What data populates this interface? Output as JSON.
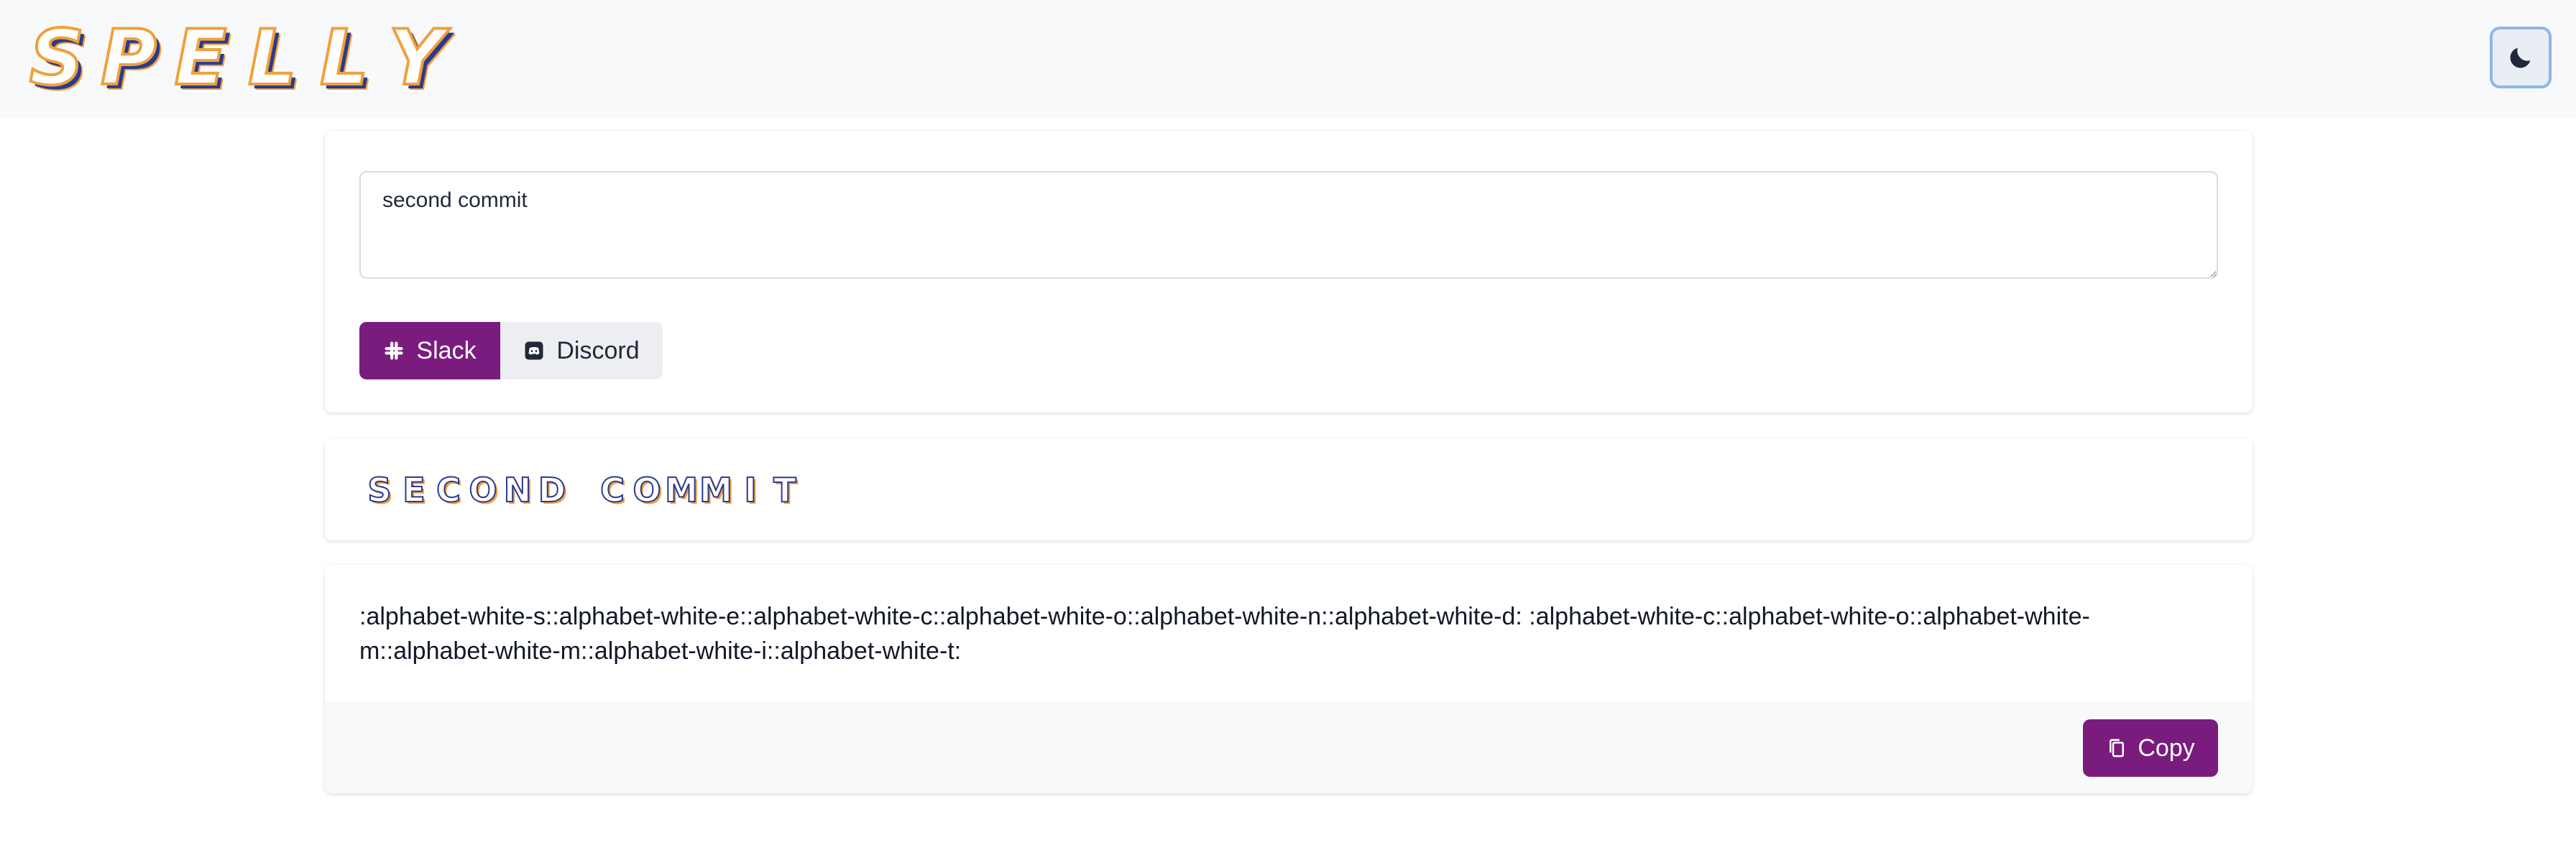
{
  "header": {
    "logo_letters": [
      "S",
      "P",
      "E",
      "L",
      "L",
      "Y"
    ],
    "theme_toggle_icon": "moon-icon"
  },
  "input": {
    "value": "second commit"
  },
  "platforms": {
    "slack_label": "Slack",
    "discord_label": "Discord",
    "selected": "Slack"
  },
  "preview": {
    "letters": [
      "S",
      "E",
      "C",
      "O",
      "N",
      "D",
      " ",
      "C",
      "O",
      "M",
      "M",
      "I",
      "T"
    ]
  },
  "output": {
    "text": ":alphabet-white-s::alphabet-white-e::alphabet-white-c::alphabet-white-o::alphabet-white-n::alphabet-white-d:   :alphabet-white-c::alphabet-white-o::alphabet-white-m::alphabet-white-m::alphabet-white-i::alphabet-white-t:",
    "copy_label": "Copy"
  },
  "colors": {
    "brand_purple": "#7a1c7e",
    "logo_orange": "#f0a03a",
    "logo_navy": "#2b3a8f"
  }
}
